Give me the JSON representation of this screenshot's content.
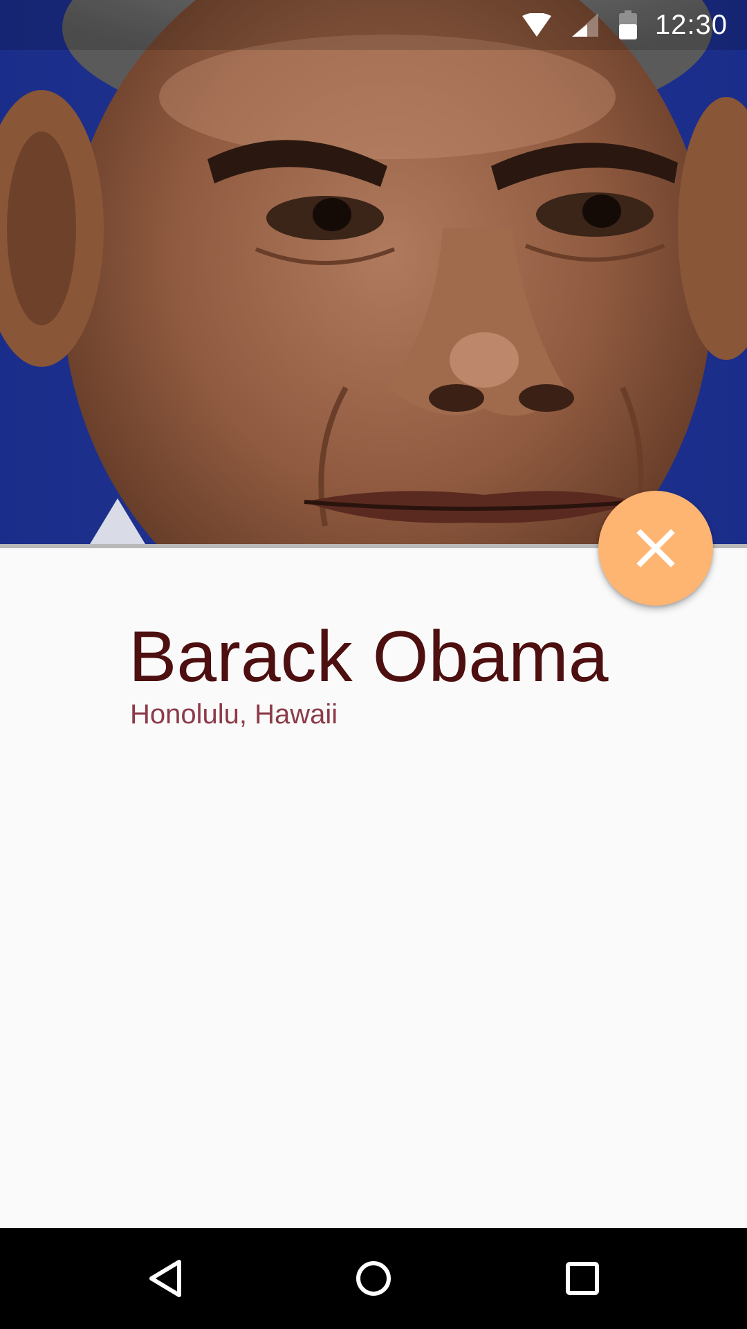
{
  "status_bar": {
    "time": "12:30",
    "icons": [
      "wifi-icon",
      "cell-signal-icon",
      "battery-icon"
    ],
    "background": "#000000"
  },
  "header": {
    "image": "portrait-photo",
    "background_color": "#1d2f86"
  },
  "profile": {
    "name": "Barack Obama",
    "location": "Honolulu, Hawaii",
    "name_color": "#4d0f0f",
    "location_color": "#8c3b48"
  },
  "fab": {
    "icon": "close-icon",
    "color": "#ffb572"
  },
  "nav_bar": {
    "buttons": [
      "back-icon",
      "home-icon",
      "recents-icon"
    ]
  }
}
